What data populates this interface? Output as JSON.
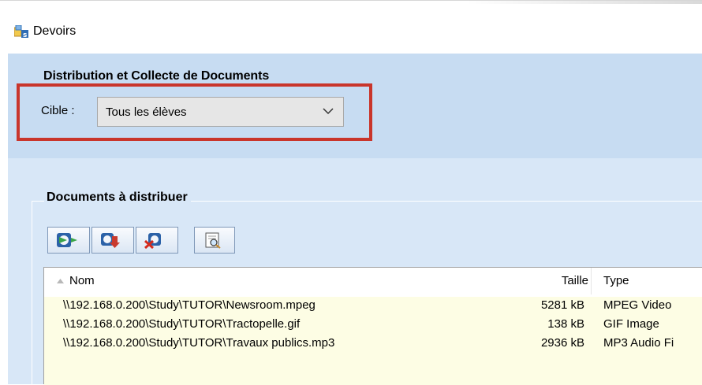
{
  "window": {
    "title": "Devoirs"
  },
  "distribution": {
    "section_title": "Distribution et Collecte de Documents",
    "target_label": "Cible :",
    "target_value": "Tous les élèves"
  },
  "documents": {
    "group_title": "Documents à distribuer",
    "toolbar": [
      {
        "icon": "add-document-icon"
      },
      {
        "icon": "move-document-icon"
      },
      {
        "icon": "remove-document-icon"
      },
      {
        "icon": "preview-document-icon"
      }
    ],
    "columns": {
      "name": "Nom",
      "size": "Taille",
      "type": "Type"
    },
    "files": [
      {
        "name": "\\\\192.168.0.200\\Study\\TUTOR\\Newsroom.mpeg",
        "size": "5281 kB",
        "type": "MPEG Video"
      },
      {
        "name": "\\\\192.168.0.200\\Study\\TUTOR\\Tractopelle.gif",
        "size": "138 kB",
        "type": "GIF Image"
      },
      {
        "name": "\\\\192.168.0.200\\Study\\TUTOR\\Travaux publics.mp3",
        "size": "2936 kB",
        "type": "MP3 Audio Fi"
      }
    ]
  },
  "colors": {
    "header_band": "#c7dcf2",
    "body_band": "#d8e7f7",
    "highlight": "#c9352b",
    "row_background": "#fdfde4"
  }
}
